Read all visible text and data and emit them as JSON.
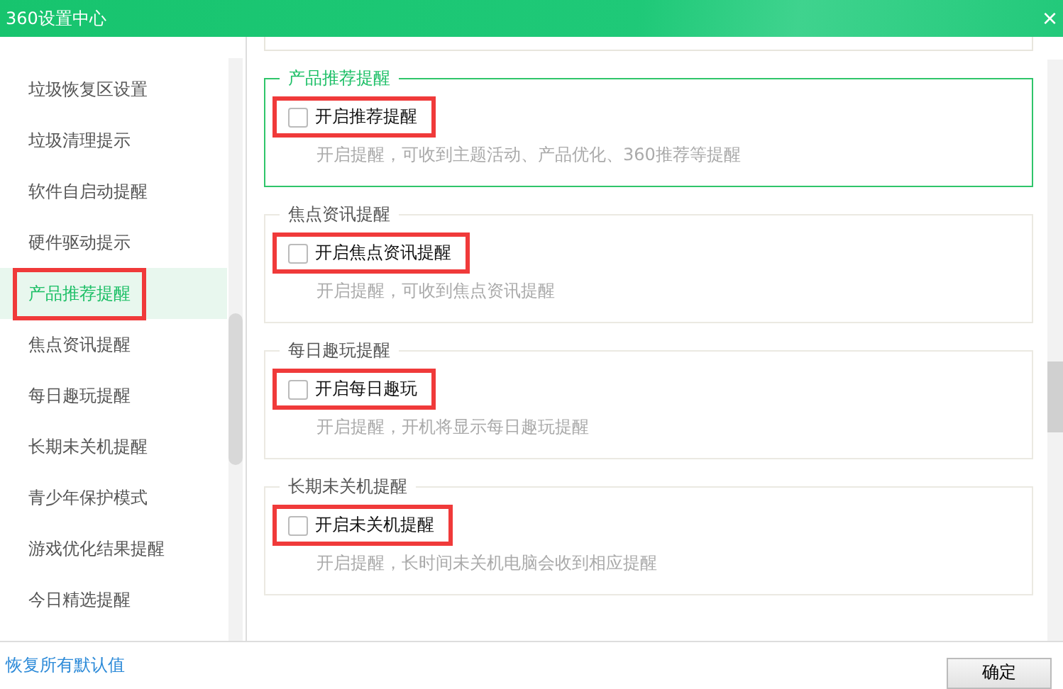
{
  "window": {
    "title": "360设置中心",
    "close": "×"
  },
  "sidebar": {
    "items": [
      {
        "label": "垃圾恢复区设置",
        "selected": false,
        "highlighted": false
      },
      {
        "label": "垃圾清理提示",
        "selected": false,
        "highlighted": false
      },
      {
        "label": "软件自启动提醒",
        "selected": false,
        "highlighted": false
      },
      {
        "label": "硬件驱动提示",
        "selected": false,
        "highlighted": false
      },
      {
        "label": "产品推荐提醒",
        "selected": true,
        "highlighted": true
      },
      {
        "label": "焦点资讯提醒",
        "selected": false,
        "highlighted": false
      },
      {
        "label": "每日趣玩提醒",
        "selected": false,
        "highlighted": false
      },
      {
        "label": "长期未关机提醒",
        "selected": false,
        "highlighted": false
      },
      {
        "label": "青少年保护模式",
        "selected": false,
        "highlighted": false
      },
      {
        "label": "游戏优化结果提醒",
        "selected": false,
        "highlighted": false
      },
      {
        "label": "今日精选提醒",
        "selected": false,
        "highlighted": false
      }
    ]
  },
  "sections": [
    {
      "title": "产品推荐提醒",
      "active": true,
      "option": {
        "label": "开启推荐提醒",
        "checked": false,
        "highlighted": true
      },
      "description": "开启提醒，可收到主题活动、产品优化、360推荐等提醒"
    },
    {
      "title": "焦点资讯提醒",
      "active": false,
      "option": {
        "label": "开启焦点资讯提醒",
        "checked": false,
        "highlighted": true
      },
      "description": "开启提醒，可收到焦点资讯提醒"
    },
    {
      "title": "每日趣玩提醒",
      "active": false,
      "option": {
        "label": "开启每日趣玩",
        "checked": false,
        "highlighted": true
      },
      "description": "开启提醒，开机将显示每日趣玩提醒"
    },
    {
      "title": "长期未关机提醒",
      "active": false,
      "option": {
        "label": "开启未关机提醒",
        "checked": false,
        "highlighted": true
      },
      "description": "开启提醒，长时间未关机电脑会收到相应提醒"
    }
  ],
  "footer": {
    "restore_link": "恢复所有默认值",
    "ok_button": "确定"
  }
}
